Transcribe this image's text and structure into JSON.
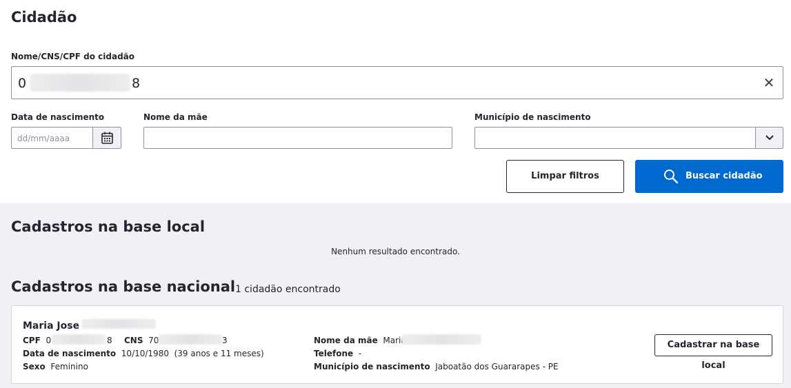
{
  "page": {
    "title": "Cidadão"
  },
  "search": {
    "label": "Nome/CNS/CPF do cidadão",
    "value_start": "0",
    "value_end": "8",
    "clear_icon": "close-icon"
  },
  "filters": {
    "birth_date": {
      "label": "Data de nascimento",
      "placeholder": "dd/mm/aaaa",
      "icon": "calendar-icon"
    },
    "mother_name": {
      "label": "Nome da mãe",
      "value": ""
    },
    "birth_city": {
      "label": "Município de nascimento",
      "value": "",
      "icon": "chevron-down-icon"
    }
  },
  "actions": {
    "clear_label": "Limpar filtros",
    "search_label": "Buscar cidadão",
    "search_icon": "search-icon",
    "primary_color": "#0069d0"
  },
  "local_base": {
    "title": "Cadastros na base local",
    "empty_message": "Nenhum resultado encontrado."
  },
  "national_base": {
    "title": "Cadastros na base nacional",
    "count_text": "1 cidadão encontrado",
    "results": [
      {
        "name": "Maria Jose",
        "cpf_label": "CPF",
        "cpf_start": "0",
        "cpf_end": "8",
        "cns_label": "CNS",
        "cns_start": "70",
        "cns_end": "3",
        "birth_label": "Data de nascimento",
        "birth_value": "10/10/1980",
        "age_text": "(39 anos e 11 meses)",
        "sex_label": "Sexo",
        "sex_value": "Feminino",
        "mother_label": "Nome da mãe",
        "mother_value": "Maria",
        "phone_label": "Telefone",
        "phone_value": "-",
        "city_label": "Município de nascimento",
        "city_value": "Jaboatão dos Guararapes - PE",
        "register_label": "Cadastrar na base local"
      }
    ]
  }
}
